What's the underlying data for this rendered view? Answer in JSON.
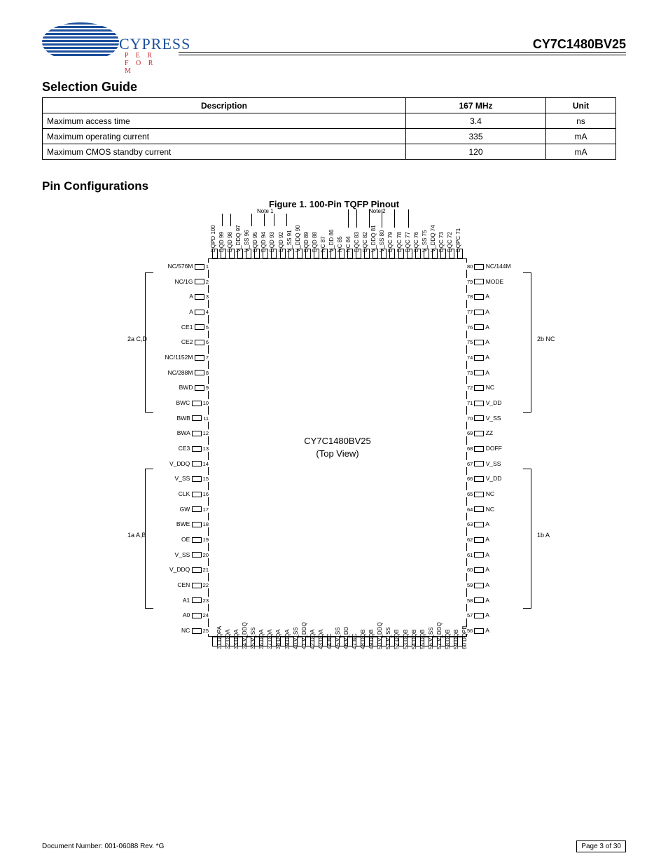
{
  "header": {
    "logo_text": "CYPRESS",
    "logo_sub": "P E R F O R M",
    "part_number": "CY7C1480BV25"
  },
  "section_mode_title": "Selection Guide",
  "table": {
    "headers": [
      "Description",
      "167 MHz",
      "Unit"
    ],
    "rows": [
      [
        "Maximum access time",
        "3.4",
        "ns"
      ],
      [
        "Maximum operating current",
        "335",
        "mA"
      ],
      [
        "Maximum CMOS standby current",
        "120",
        "mA"
      ]
    ]
  },
  "section_pkg_title": "Pin Configurations",
  "figure_title": "Figure 1. 100-Pin TQFP Pinout",
  "chip_name_l1": "CY7C1480BV25",
  "chip_name_l2": "(Top View)",
  "left_pins": [
    "NC/576M",
    "NC/1G",
    "A",
    "A",
    "CE1",
    "CE2",
    "NC/1152M",
    "NC/288M",
    "BWD",
    "BWC",
    "BWB",
    "BWA",
    "CE3",
    "V_DDQ",
    "V_SS",
    "CLK",
    "GW",
    "BWE",
    "OE",
    "V_SS",
    "V_DDQ",
    "CEN",
    "A1",
    "A0",
    "NC"
  ],
  "left_span_a": "A",
  "left_span_b": "A",
  "left_span_c": "A",
  "right_pins": [
    "NC/144M",
    "MODE",
    "A",
    "A",
    "A",
    "A",
    "A",
    "A",
    "NC",
    "V_DD",
    "V_SS",
    "ZZ",
    "DOFF",
    "V_SS",
    "V_DD",
    "NC",
    "NC",
    "A",
    "A",
    "A",
    "A",
    "A",
    "A",
    "A",
    "A"
  ],
  "top_pins": [
    "DQPD",
    "DQD",
    "DQD",
    "V_DDQ",
    "V_SS",
    "DQD",
    "DQD",
    "DQD",
    "DQD",
    "V_SS",
    "V_DDQ",
    "DQD",
    "DQD",
    "NC",
    "V_DD",
    "NC",
    "NC",
    "DQC",
    "DQC",
    "V_DDQ",
    "V_SS",
    "DQC",
    "DQC",
    "DQC",
    "DQC",
    "V_SS",
    "V_DDQ",
    "DQC",
    "DQC",
    "DQPC"
  ],
  "bot_pins": [
    "DQPA",
    "DQA",
    "DQA",
    "V_DDQ",
    "V_SS",
    "DQA",
    "DQA",
    "DQA",
    "DQA",
    "V_SS",
    "V_DDQ",
    "DQA",
    "DQA",
    "NC",
    "V_SS",
    "V_DD",
    "NC",
    "DQB",
    "DQB",
    "V_DDQ",
    "V_SS",
    "DQB",
    "DQB",
    "DQB",
    "DQB",
    "V_SS",
    "V_DDQ",
    "DQB",
    "DQB",
    "DQPB"
  ],
  "top_nums_start": 100,
  "left_nums_start": 1,
  "right_nums_start": 80,
  "bot_nums_start": 31,
  "note1": "Note 1",
  "note2": "Note 2",
  "port_2a": "2a\nC,D",
  "port_1a": "1a\nA,B",
  "port_2b": "2b\nNC",
  "port_1b": "1b\nA",
  "footer": {
    "doc": "Document Number: 001-06088 Rev. *G",
    "page": "Page 3 of 30"
  }
}
